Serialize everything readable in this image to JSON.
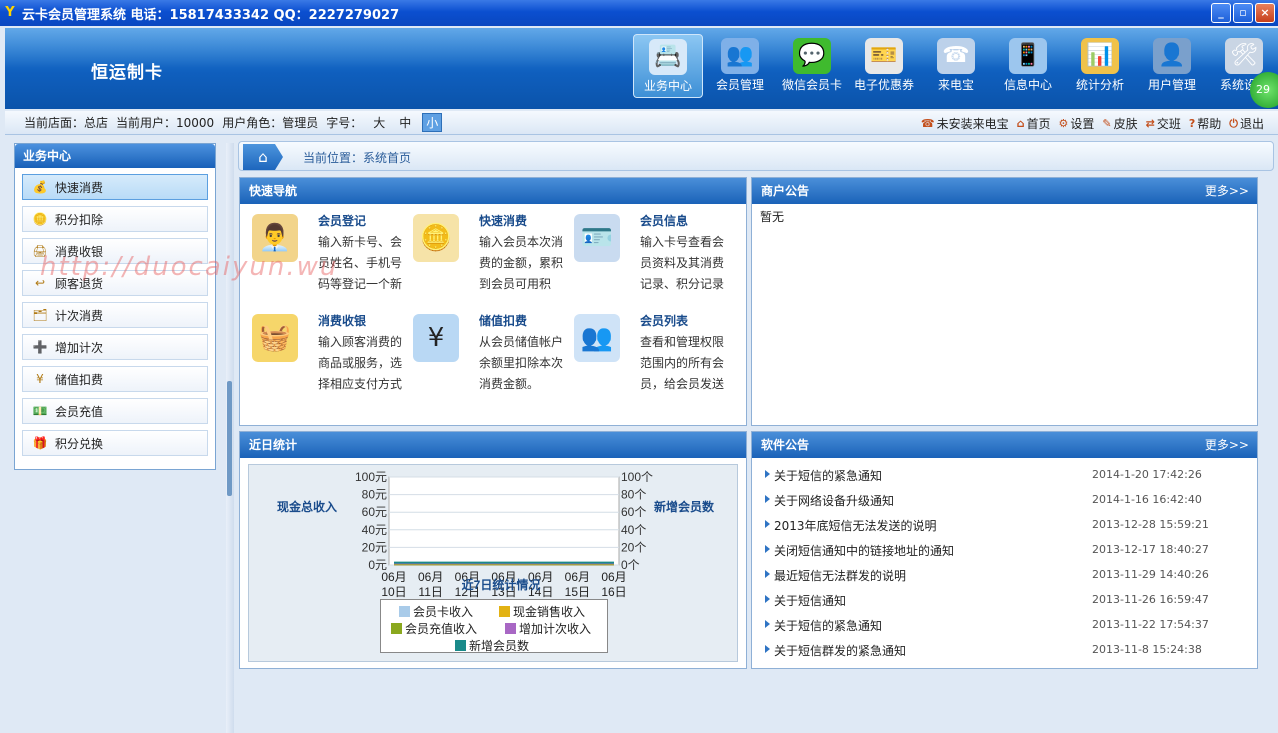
{
  "window": {
    "title": "云卡会员管理系统 电话：15817433342 QQ：2227279027",
    "min": "_",
    "max": "▫",
    "close": "×"
  },
  "brand": "恒运制卡",
  "nav": [
    {
      "label": "业务中心",
      "icon": "📇",
      "bg": "#d7e9f9"
    },
    {
      "label": "会员管理",
      "icon": "👥",
      "bg": "#7fb0e8"
    },
    {
      "label": "微信会员卡",
      "icon": "💬",
      "bg": "#3fba2e"
    },
    {
      "label": "电子优惠券",
      "icon": "🎫",
      "bg": "#e8e8e8"
    },
    {
      "label": "来电宝",
      "icon": "☎",
      "bg": "#bcd1ea"
    },
    {
      "label": "信息中心",
      "icon": "📱",
      "bg": "#9cc6ee"
    },
    {
      "label": "统计分析",
      "icon": "📊",
      "bg": "#f0c24a"
    },
    {
      "label": "用户管理",
      "icon": "👤",
      "bg": "#7aa0cc"
    },
    {
      "label": "系统设置",
      "icon": "🛠",
      "bg": "#c9d5e4"
    }
  ],
  "nav_badge": "29",
  "info": {
    "store": "当前店面：总店",
    "user": "当前用户：10000",
    "role": "用户角色：管理员",
    "font_label": "字号：",
    "fonts": [
      "大",
      "中",
      "小"
    ]
  },
  "tools": {
    "phone": "未安装来电宝",
    "home": "首页",
    "settings": "设置",
    "skin": "皮肤",
    "shift": "交班",
    "help": "帮助",
    "logout": "退出"
  },
  "sidebar": {
    "title": "业务中心",
    "items": [
      {
        "label": "快速消费",
        "icon": "💰"
      },
      {
        "label": "积分扣除",
        "icon": "🪙"
      },
      {
        "label": "消费收银",
        "icon": "🖨"
      },
      {
        "label": "顾客退货",
        "icon": "↩"
      },
      {
        "label": "计次消费",
        "icon": "🗂"
      },
      {
        "label": "增加计次",
        "icon": "➕"
      },
      {
        "label": "储值扣费",
        "icon": "¥"
      },
      {
        "label": "会员充值",
        "icon": "💵"
      },
      {
        "label": "积分兑换",
        "icon": "🎁"
      }
    ]
  },
  "breadcrumb": "当前位置：系统首页",
  "watermark": "http://duocaiyun.wu",
  "quicknav": {
    "title": "快速导航",
    "items": [
      {
        "title": "会员登记",
        "desc": "输入新卡号、会员姓名、手机号码等登记一个新",
        "icon": "👨‍💼",
        "bg": "#f2d48a"
      },
      {
        "title": "快速消费",
        "desc": "输入会员本次消费的金额，累积到会员可用积",
        "icon": "🪙",
        "bg": "#f6e3a8"
      },
      {
        "title": "会员信息",
        "desc": "输入卡号查看会员资料及其消费记录、积分记录",
        "icon": "🪪",
        "bg": "#c9dbf0"
      },
      {
        "title": "消费收银",
        "desc": "输入顾客消费的商品或服务，选择相应支付方式",
        "icon": "🧺",
        "bg": "#f6d66a"
      },
      {
        "title": "储值扣费",
        "desc": "从会员储值帐户余额里扣除本次消费金额。",
        "icon": "¥",
        "bg": "#b9d8f4"
      },
      {
        "title": "会员列表",
        "desc": "查看和管理权限范围内的所有会员，给会员发送",
        "icon": "👥",
        "bg": "#cfe3f7"
      }
    ]
  },
  "merchant_notice": {
    "title": "商户公告",
    "more": "更多>>",
    "content": "暂无"
  },
  "stats": {
    "title": "近日统计"
  },
  "chart_data": {
    "type": "line",
    "title": "近7日统计情况",
    "left_axis_label": "现金总收入",
    "right_axis_label": "新增会员数",
    "categories": [
      "06月10日",
      "06月11日",
      "06月12日",
      "06月13日",
      "06月14日",
      "06月15日",
      "06月16日"
    ],
    "left_ticks": [
      "100元",
      "80元",
      "60元",
      "40元",
      "20元",
      "0元"
    ],
    "right_ticks": [
      "100个",
      "80个",
      "60个",
      "40个",
      "20个",
      "0个"
    ],
    "ylim": [
      0,
      100
    ],
    "series": [
      {
        "name": "会员卡收入",
        "color": "#a9cbe9",
        "values": [
          0,
          0,
          0,
          0,
          0,
          0,
          0
        ]
      },
      {
        "name": "现金销售收入",
        "color": "#e2b214",
        "values": [
          0,
          0,
          0,
          0,
          0,
          0,
          0
        ]
      },
      {
        "name": "会员充值收入",
        "color": "#8aa81e",
        "values": [
          0,
          0,
          0,
          0,
          0,
          0,
          0
        ]
      },
      {
        "name": "增加计次收入",
        "color": "#a867c4",
        "values": [
          0,
          0,
          0,
          0,
          0,
          0,
          0
        ]
      },
      {
        "name": "新增会员数",
        "color": "#1a8a8a",
        "values": [
          0,
          0,
          0,
          0,
          0,
          0,
          0
        ]
      }
    ]
  },
  "software_notice": {
    "title": "软件公告",
    "more": "更多>>",
    "items": [
      {
        "title": "关于短信的紧急通知",
        "date": "2014-1-20 17:42:26"
      },
      {
        "title": "关于网络设备升级通知",
        "date": "2014-1-16 16:42:40"
      },
      {
        "title": "2013年底短信无法发送的说明",
        "date": "2013-12-28 15:59:21"
      },
      {
        "title": "关闭短信通知中的链接地址的通知",
        "date": "2013-12-17 18:40:27"
      },
      {
        "title": "最近短信无法群发的说明",
        "date": "2013-11-29 14:40:26"
      },
      {
        "title": "关于短信通知",
        "date": "2013-11-26 16:59:47"
      },
      {
        "title": "关于短信的紧急通知",
        "date": "2013-11-22 17:54:37"
      },
      {
        "title": "关于短信群发的紧急通知",
        "date": "2013-11-8 15:24:38"
      }
    ]
  }
}
